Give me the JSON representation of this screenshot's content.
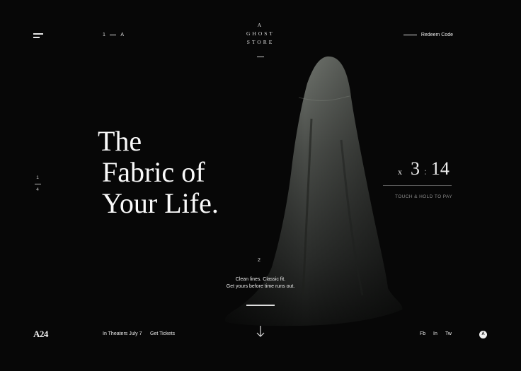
{
  "header": {
    "pager": {
      "current": "1",
      "next": "A"
    },
    "logo": {
      "line1": "A",
      "line2": "GHOST",
      "line3": "STORE"
    },
    "redeem_label": "Redeem Code"
  },
  "side_pager": {
    "current": "1",
    "total": "4"
  },
  "hero": {
    "line1": "The",
    "line2": "Fabric of",
    "line3": "Your Life."
  },
  "timer": {
    "prefix": "x",
    "minutes": "3",
    "separator": ":",
    "seconds": "14",
    "action_label": "TOUCH & HOLD TO PAY"
  },
  "step": {
    "number": "2",
    "caption_line1": "Clean lines. Classic fit.",
    "caption_line2": "Get yours before time runs out."
  },
  "footer": {
    "brand": "A24",
    "release_text": "In Theaters July 7",
    "tickets_label": "Get Tickets",
    "social": [
      "Fb",
      "In",
      "Tw"
    ],
    "badge": "A"
  },
  "colors": {
    "background": "#070707",
    "text": "#fafafa",
    "muted": "#8a8a8a"
  },
  "icons": {
    "menu": "hamburger-menu-icon",
    "down": "arrow-down-icon"
  }
}
